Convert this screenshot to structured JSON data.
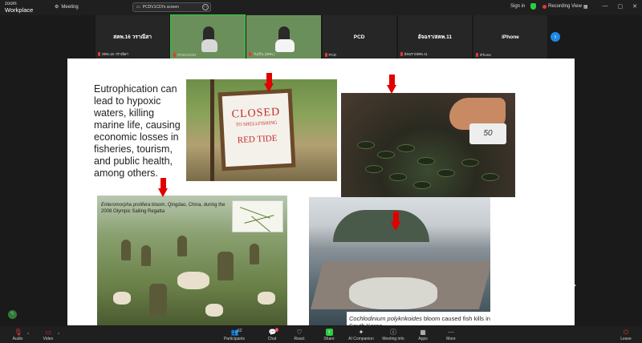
{
  "app": {
    "logo_line1": "zoom",
    "logo_line2": "Workplace"
  },
  "topbar": {
    "meeting_label": "Meeting",
    "screen_pill_label": "PCDV1CDI's screen",
    "signin": "Sign in",
    "recording": "Recording",
    "view": "View",
    "win_minimize": "—",
    "win_maximize": "▢",
    "win_close": "✕"
  },
  "participants": [
    {
      "title": "สคพ.16 วราณีสา",
      "name": "สคพ.16 วราณีสา",
      "kind": "name"
    },
    {
      "title": "",
      "name": "PCDV1CDI",
      "kind": "video"
    },
    {
      "title": "",
      "name": "วันเปิน (สคพ.)",
      "kind": "video"
    },
    {
      "title": "PCD",
      "name": "PCD",
      "kind": "name"
    },
    {
      "title": "อัจฉรา/สคพ.11",
      "name": "อัจฉรา/สคพ.11",
      "kind": "name"
    },
    {
      "title": "iPhone",
      "name": "iPhone",
      "kind": "name"
    }
  ],
  "slide": {
    "body": "Eutrophication can lead to hypoxic waters, killing marine life, causing economic losses in fisheries, tourism, and public health, among others.",
    "sign_line1": "CLOSED",
    "sign_line2": "TO SHELLFISHING",
    "sign_line3": "RED TIDE",
    "price_card": "50",
    "caption1_species": "Enteromorpha prolifera",
    "caption1_rest": " bloom, Qingdao, China, during the 2008 Olympic Sailing Regatta",
    "caption2_species": "Cochlodinium polykrikoides",
    "caption2_rest": " bloom caused fish kills in South Korea,"
  },
  "toolbar": {
    "audio": "Audio",
    "video": "Video",
    "participants": "Participants",
    "participants_count": "62",
    "chat": "Chat",
    "chat_badge": "1",
    "react": "React",
    "share": "Share",
    "ai_companion": "AI Companion",
    "meeting_info": "Meeting info",
    "apps": "Apps",
    "more": "More",
    "leave": "Leave"
  },
  "colors": {
    "accent_green": "#2ecc40",
    "recording_red": "#e53935",
    "arrow_red": "#e10000",
    "nav_blue": "#1e88e5"
  }
}
